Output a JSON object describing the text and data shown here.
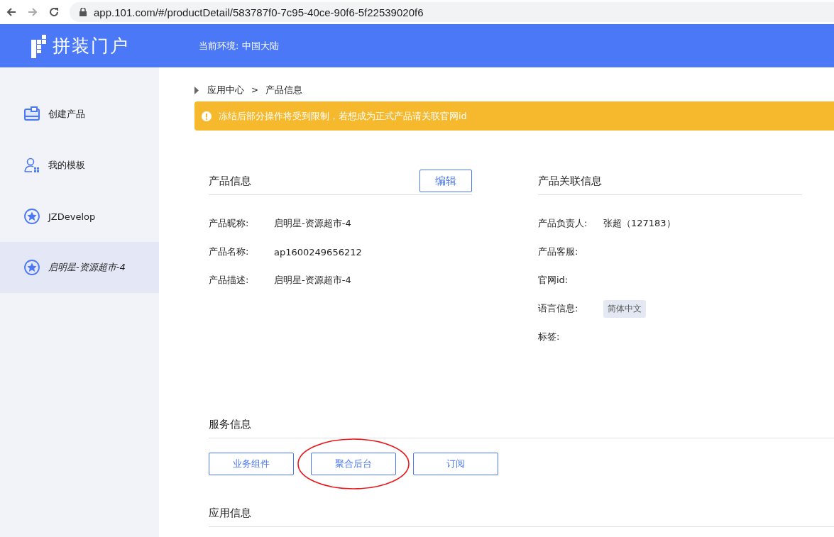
{
  "browser": {
    "url": "app.101.com/#/productDetail/583787f0-7c95-40ce-90f6-5f22539020f6"
  },
  "header": {
    "logo": "拼装门户",
    "environment": "当前环境: 中国大陆"
  },
  "sidebar": {
    "items": [
      {
        "label": "创建产品",
        "kind": "create",
        "selected": false
      },
      {
        "label": "我的模板",
        "kind": "template",
        "selected": false
      },
      {
        "label": "JZDevelop",
        "kind": "star",
        "selected": false
      },
      {
        "label": "启明星-资源超市-4",
        "kind": "star",
        "selected": true
      }
    ]
  },
  "breadcrumb": [
    "应用中心",
    "产品信息"
  ],
  "breadcrumb_separator": ">",
  "alert": "冻结后部分操作将受到限制，若想成为正式产品请关联官网id",
  "product_info": {
    "title": "产品信息",
    "edit_button": "编辑",
    "fields": [
      {
        "label": "产品昵称:",
        "value": "启明星-资源超市-4"
      },
      {
        "label": "产品名称:",
        "value": "ap1600249656212"
      },
      {
        "label": "产品描述:",
        "value": "启明星-资源超市-4"
      }
    ]
  },
  "related_info": {
    "title": "产品关联信息",
    "fields": [
      {
        "label": "产品负责人:",
        "value": "张超（127183）",
        "kind": "text"
      },
      {
        "label": "产品客服:"
      },
      {
        "label": "官网id:"
      },
      {
        "label": "语言信息:",
        "value": "简体中文",
        "kind": "tag"
      },
      {
        "label": "标签:"
      }
    ]
  },
  "service_info": {
    "title": "服务信息",
    "buttons": [
      {
        "label": "业务组件",
        "circled": false
      },
      {
        "label": "聚合后台",
        "circled": true
      },
      {
        "label": "订阅",
        "circled": false
      }
    ]
  },
  "app_info": {
    "title": "应用信息"
  }
}
